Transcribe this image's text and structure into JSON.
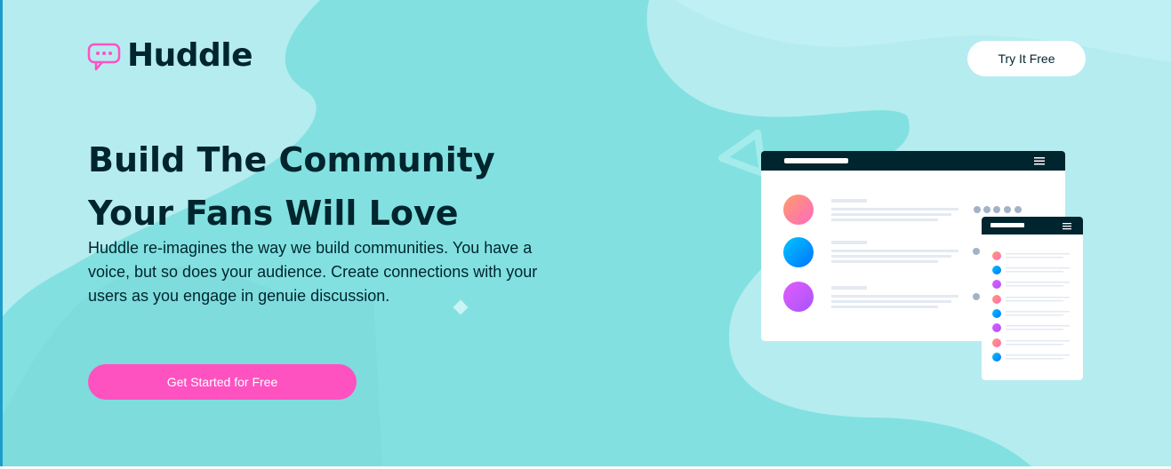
{
  "brand": {
    "name": "Huddle",
    "accent": "#ff52c1",
    "dark": "#00252e",
    "background": "#82e1e0"
  },
  "header": {
    "logo_icon": "chat-bubble-icon",
    "cta_label": "Try It Free"
  },
  "hero": {
    "title_line1": "Build The Community",
    "title_line2": "Your Fans Will Love",
    "description": "Huddle re-imagines the way we build communities. You have a voice, but so does your audience. Create connections with your users as you engage in genuie discussion.",
    "cta_label": "Get Started for Free"
  }
}
